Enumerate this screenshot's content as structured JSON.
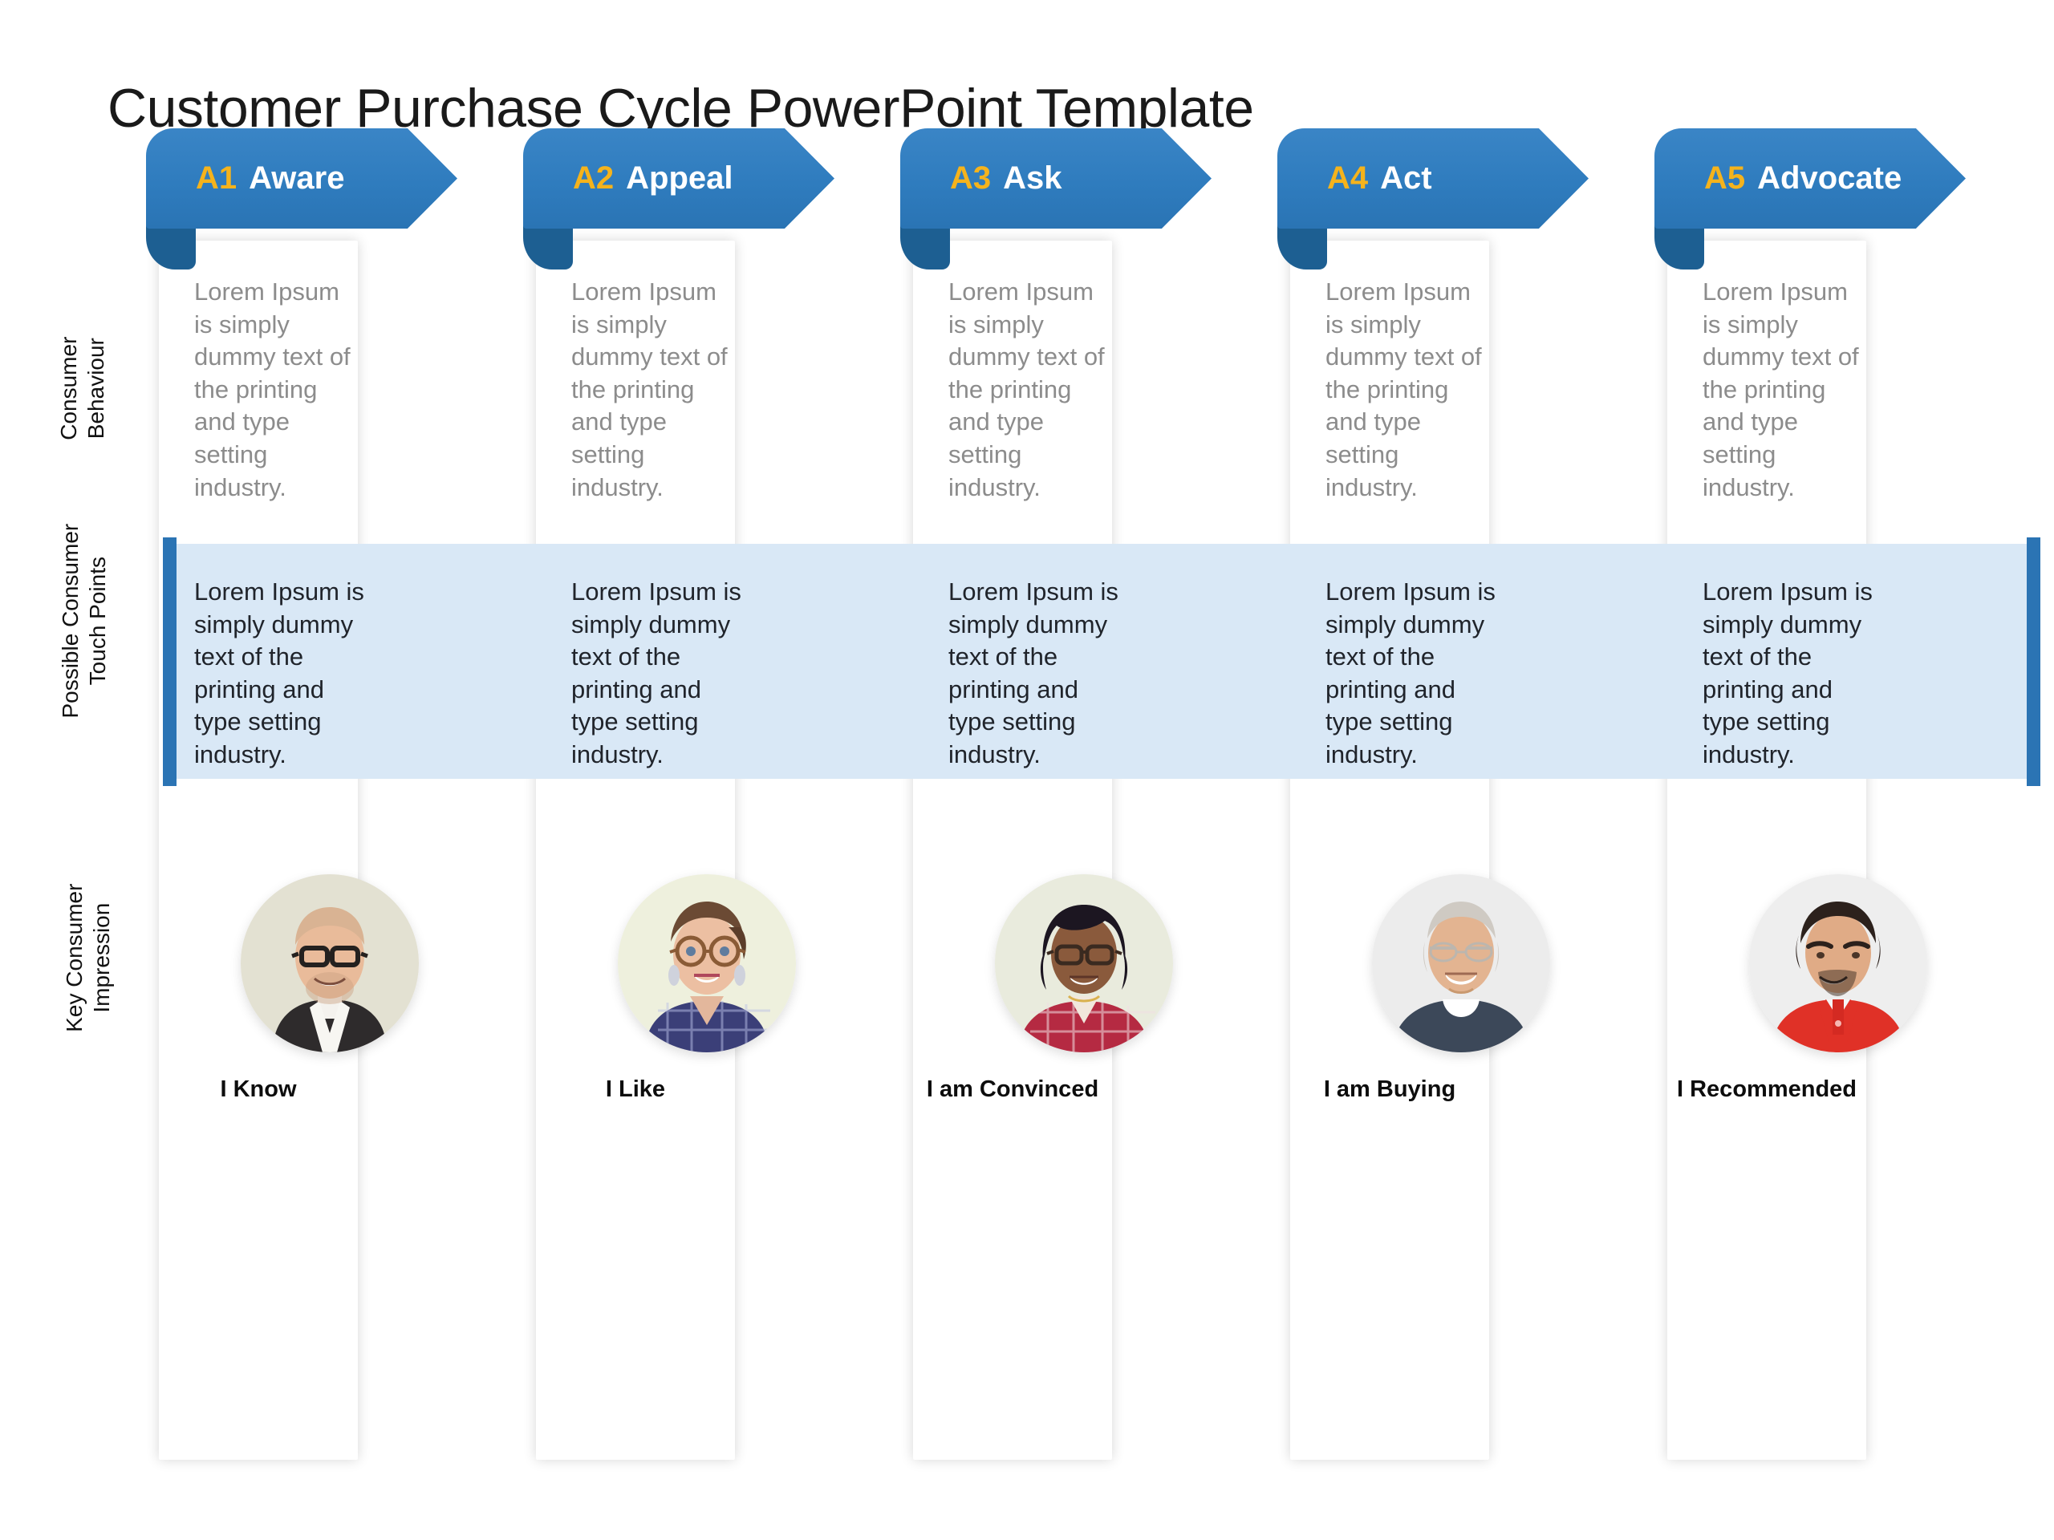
{
  "slide": {
    "title": "Customer Purchase Cycle PowerPoint Template"
  },
  "row_labels": [
    {
      "id": "consumer-behaviour",
      "text": "Consumer\nBehaviour"
    },
    {
      "id": "possible-consumer-touch-points",
      "text": "Possible Consumer\nTouch Points"
    },
    {
      "id": "key-consumer-impression",
      "text": "Key Consumer\nImpression"
    }
  ],
  "colors": {
    "banner_blue": "#2f7cbe",
    "banner_tail_blue": "#1d5f92",
    "banner_code_gold": "#f5b31c",
    "band_fill": "#d9e8f6",
    "band_edge": "#2b74b4",
    "row1_text": "#8c8c8c",
    "row2_text": "#20242b"
  },
  "stages": [
    {
      "code": "A1",
      "label": "Aware",
      "behaviour": "Lorem Ipsum is simply dummy text of the printing and type setting industry.",
      "touch_points": "Lorem Ipsum is simply dummy text of the printing and  type setting industry.",
      "impression": "I Know",
      "avatar": {
        "name": "avatar-bald-man-glasses-suit",
        "bg": "#e3e1d2",
        "skin": "#e9bb9a",
        "hair": "#b49a80",
        "clothes": "#2e2b2c",
        "accent": "#f4f2ee"
      }
    },
    {
      "code": "A2",
      "label": "Appeal",
      "behaviour": "Lorem Ipsum is simply dummy text of the printing and type setting industry.",
      "touch_points": "Lorem Ipsum is simply dummy text of the printing and type setting industry.",
      "impression": "I Like",
      "avatar": {
        "name": "avatar-woman-round-glasses-plaid",
        "bg": "#eef0dd",
        "skin": "#ecbfa2",
        "hair": "#6b4a34",
        "clothes": "#3b3f78",
        "accent": "#8e93c9"
      }
    },
    {
      "code": "A3",
      "label": "Ask",
      "behaviour": "Lorem Ipsum is simply dummy text of the printing and type setting industry.",
      "touch_points": "Lorem Ipsum is simply dummy text of the printing and type setting industry.",
      "impression": "I am Convinced",
      "avatar": {
        "name": "avatar-woman-bob-glasses-red-plaid",
        "bg": "#e9ebdd",
        "skin": "#8a5a3c",
        "hair": "#1c1621",
        "clothes": "#b52a42",
        "accent": "#f1e7dc"
      }
    },
    {
      "code": "A4",
      "label": "Act",
      "behaviour": "Lorem Ipsum is simply dummy text of the printing and type setting industry.",
      "touch_points": "Lorem Ipsum is simply dummy text of the printing and type setting industry.",
      "impression": "I am Buying",
      "avatar": {
        "name": "avatar-older-man-gray-hair-navy-tshirt",
        "bg": "#ececec",
        "skin": "#e3b491",
        "hair": "#cfcac3",
        "clothes": "#3c4859",
        "accent": "#ffffff"
      }
    },
    {
      "code": "A5",
      "label": "Advocate",
      "behaviour": "Lorem Ipsum is simply dummy text of the printing and type setting industry.",
      "touch_points": "Lorem Ipsum is simply dummy text of the printing and type setting industry.",
      "impression": "I Recommended",
      "avatar": {
        "name": "avatar-man-goatee-red-polo",
        "bg": "#eeeeee",
        "skin": "#e0ab86",
        "hair": "#2c211c",
        "clothes": "#e03127",
        "accent": "#ffffff"
      }
    }
  ]
}
